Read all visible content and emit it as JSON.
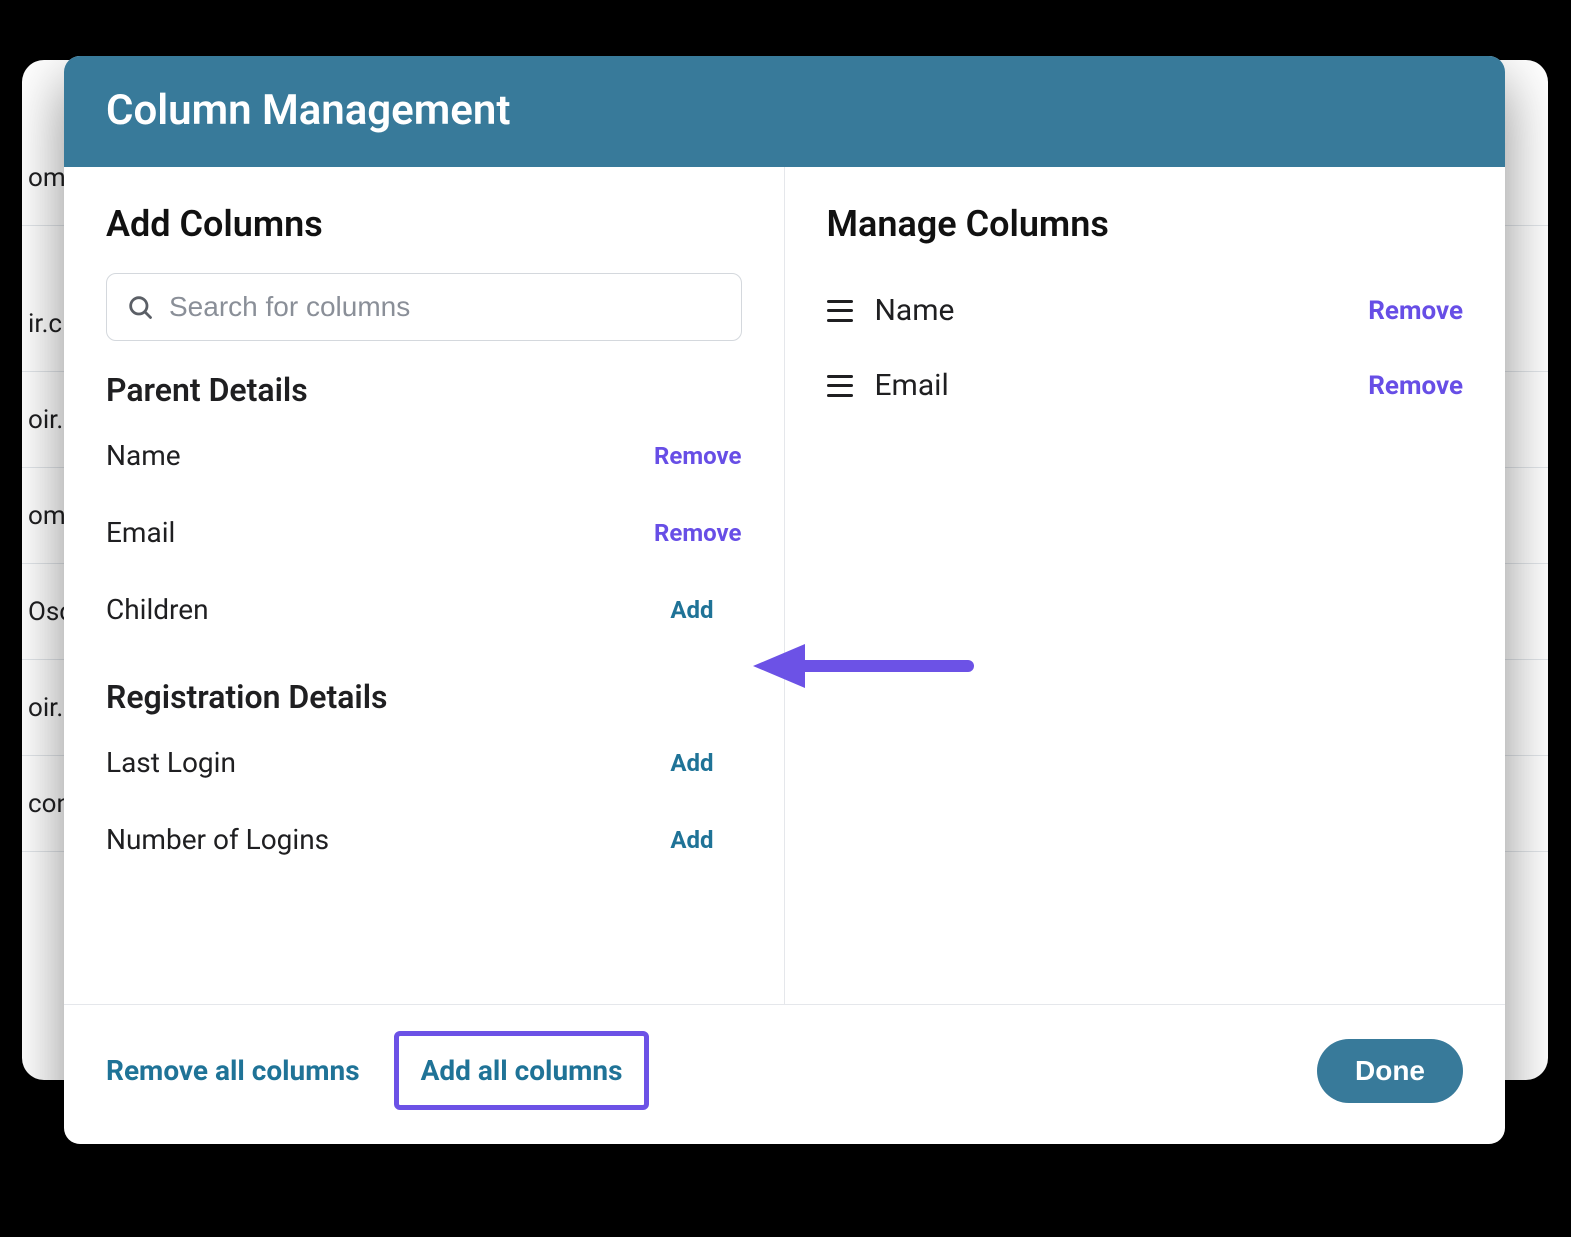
{
  "background_fragments": [
    "om",
    "ir.c",
    "oir.",
    "om",
    "Osc",
    "oir.",
    "con"
  ],
  "modal": {
    "title": "Column Management",
    "left": {
      "title": "Add Columns",
      "search_placeholder": "Search for columns",
      "groups": [
        {
          "name": "Parent Details",
          "items": [
            {
              "label": "Name",
              "action": "Remove",
              "kind": "remove"
            },
            {
              "label": "Email",
              "action": "Remove",
              "kind": "remove"
            },
            {
              "label": "Children",
              "action": "Add",
              "kind": "add"
            }
          ]
        },
        {
          "name": "Registration Details",
          "items": [
            {
              "label": "Last Login",
              "action": "Add",
              "kind": "add"
            },
            {
              "label": "Number of Logins",
              "action": "Add",
              "kind": "add"
            }
          ]
        }
      ]
    },
    "right": {
      "title": "Manage Columns",
      "items": [
        {
          "label": "Name",
          "action": "Remove"
        },
        {
          "label": "Email",
          "action": "Remove"
        }
      ]
    },
    "footer": {
      "remove_all": "Remove all columns",
      "add_all": "Add all columns",
      "done": "Done"
    }
  },
  "annotation": {
    "arrow_color": "#6c52e6",
    "highlight_color": "#6c52e6"
  }
}
